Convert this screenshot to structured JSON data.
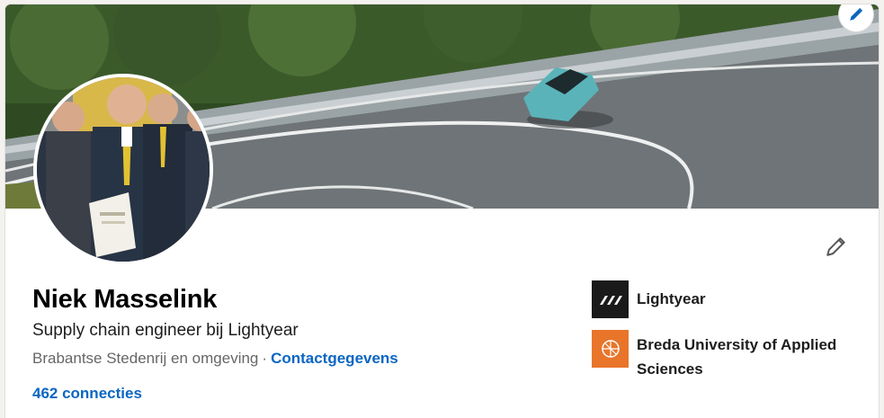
{
  "profile": {
    "name": "Niek Masselink",
    "headline": "Supply chain engineer bij Lightyear",
    "location": "Brabantse Stedenrij en omgeving",
    "separator": "·",
    "contact_link": "Contactgegevens",
    "connections": "462 connecties"
  },
  "organizations": [
    {
      "name": "Lightyear",
      "logo_icon": "lightyear-logo-icon",
      "logo_color": "#1a1a1a"
    },
    {
      "name": "Breda University of Applied Sciences",
      "logo_icon": "buas-logo-icon",
      "logo_color": "#e8752a"
    }
  ],
  "icons": {
    "banner_edit": "pencil-icon",
    "profile_edit": "pencil-icon"
  },
  "colors": {
    "link": "#0a66c2",
    "page_bg": "#f3f2ef"
  }
}
